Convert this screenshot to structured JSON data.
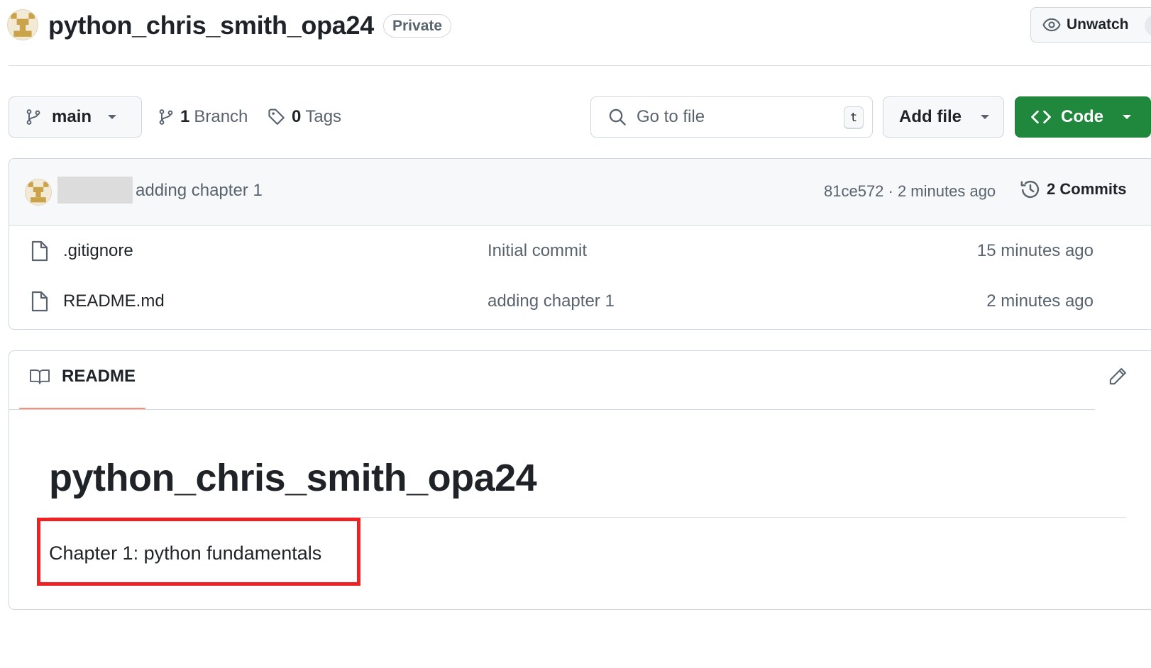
{
  "repo": {
    "name": "python_chris_smith_opa24",
    "visibility": "Private",
    "watch_label": "Unwatch"
  },
  "toolbar": {
    "branch": "main",
    "branches_count": "1",
    "branches_label": "Branch",
    "tags_count": "0",
    "tags_label": "Tags",
    "goto_file_placeholder": "Go to file",
    "goto_file_shortcut": "t",
    "add_file_label": "Add file",
    "code_label": "Code"
  },
  "latest_commit": {
    "message": "adding chapter 1",
    "meta": "81ce572 · 2 minutes ago",
    "commits_count": "2",
    "commits_label": "Commits"
  },
  "files": [
    {
      "name": ".gitignore",
      "message": "Initial commit",
      "age": "15 minutes ago"
    },
    {
      "name": "README.md",
      "message": "adding chapter 1",
      "age": "2 minutes ago"
    }
  ],
  "readme": {
    "tab_label": "README",
    "heading": "python_chris_smith_opa24",
    "paragraph": "Chapter 1: python fundamentals"
  },
  "colors": {
    "primary_button": "#1f883d",
    "active_tab_underline": "#fd8c73",
    "annotation_box": "#ee2222"
  },
  "icons": [
    "avatar-identicon",
    "eye-icon",
    "git-branch-icon",
    "tag-icon",
    "search-icon",
    "chevron-down-icon",
    "code-icon",
    "history-icon",
    "file-icon",
    "book-icon",
    "pencil-icon"
  ]
}
